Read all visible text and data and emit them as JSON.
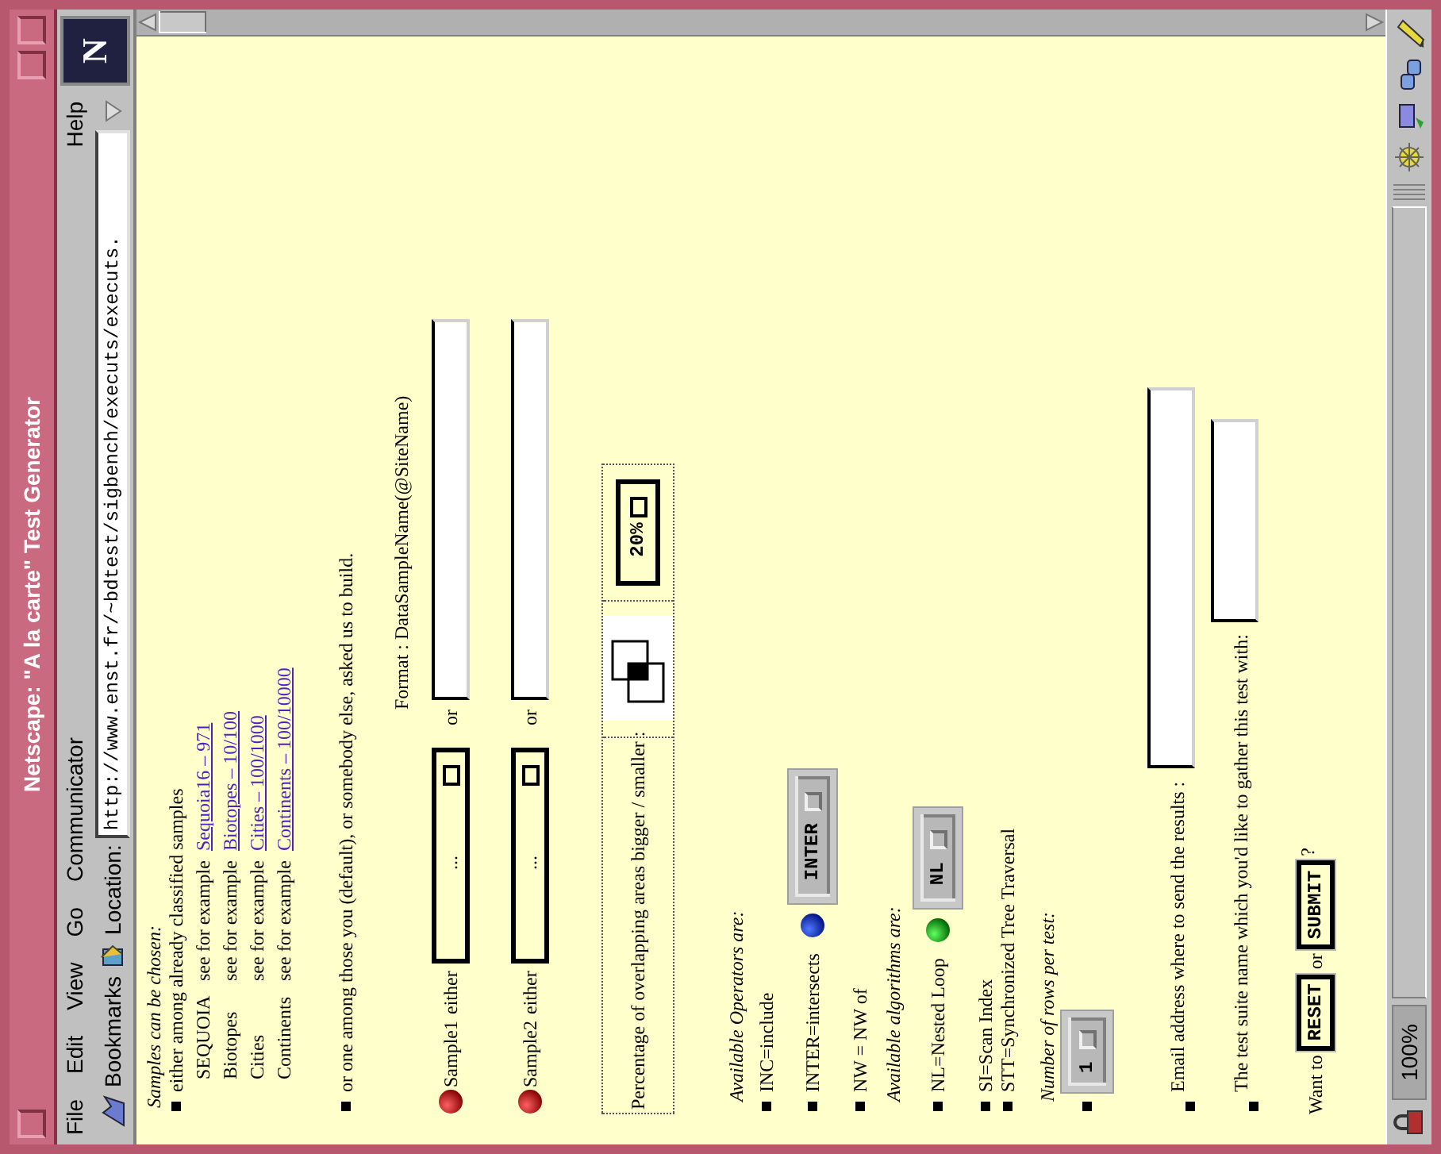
{
  "window": {
    "title": "Netscape: \"A la carte\" Test Generator"
  },
  "menu": [
    "File",
    "Edit",
    "View",
    "Go",
    "Communicator",
    "Help"
  ],
  "location_bar": {
    "bookmarks_label": "Bookmarks",
    "location_label": "Location:",
    "url": "http://www.enst.fr/~bdtest/sigbench/executs/executs.",
    "logo": "N"
  },
  "page": {
    "samples_heading": "Samples can be chosen:",
    "classified": {
      "text": "either among already classified samples",
      "rows": [
        {
          "name": "SEQUOIA",
          "hint": "see for example",
          "link": "Sequoia16 – 971"
        },
        {
          "name": "Biotopes",
          "hint": "see for example",
          "link": "Biotopes – 10/100"
        },
        {
          "name": "Cities",
          "hint": "see for example",
          "link": "Cities – 100/1000"
        },
        {
          "name": "Continents",
          "hint": "see for example",
          "link": "Continents – 100/10000"
        }
      ]
    },
    "custom_text": "or one among those you (default), or somebody else, asked us to build.",
    "format_note": "Format : DataSampleName(@SiteName)",
    "samples": [
      {
        "label": "Sample1",
        "either": "either",
        "choice": "...",
        "or": "or"
      },
      {
        "label": "Sample2",
        "either": "either",
        "choice": "...",
        "or": "or"
      }
    ],
    "overlap": {
      "label": "Percentage of overlapping areas bigger / smaller :",
      "choice": "20%"
    },
    "operators": {
      "heading": "Available Operators are:",
      "items": [
        {
          "text": "INC=include"
        },
        {
          "text": "INTER=intersects",
          "choice": "INTER"
        },
        {
          "text": "NW = NW of"
        }
      ]
    },
    "algorithms": {
      "heading": "Available algorithms are:",
      "items": [
        {
          "text": "NL=Nested Loop",
          "choice": "NL"
        },
        {
          "text": "SI=Scan Index"
        },
        {
          "text": "STT=Synchronized Tree Traversal"
        }
      ]
    },
    "rows_per_test": {
      "heading": "Number of rows per test:",
      "choice": "1"
    },
    "email": {
      "label": "Email address where to send the results :"
    },
    "suite": {
      "label": "The test suite name which you'd like to gather this test with:"
    },
    "actions": {
      "prefix": "Want to",
      "reset": "RESET",
      "or": "or",
      "submit": "SUBMIT",
      "suffix": "?"
    }
  },
  "status_bar": {
    "zoom": "100%"
  }
}
